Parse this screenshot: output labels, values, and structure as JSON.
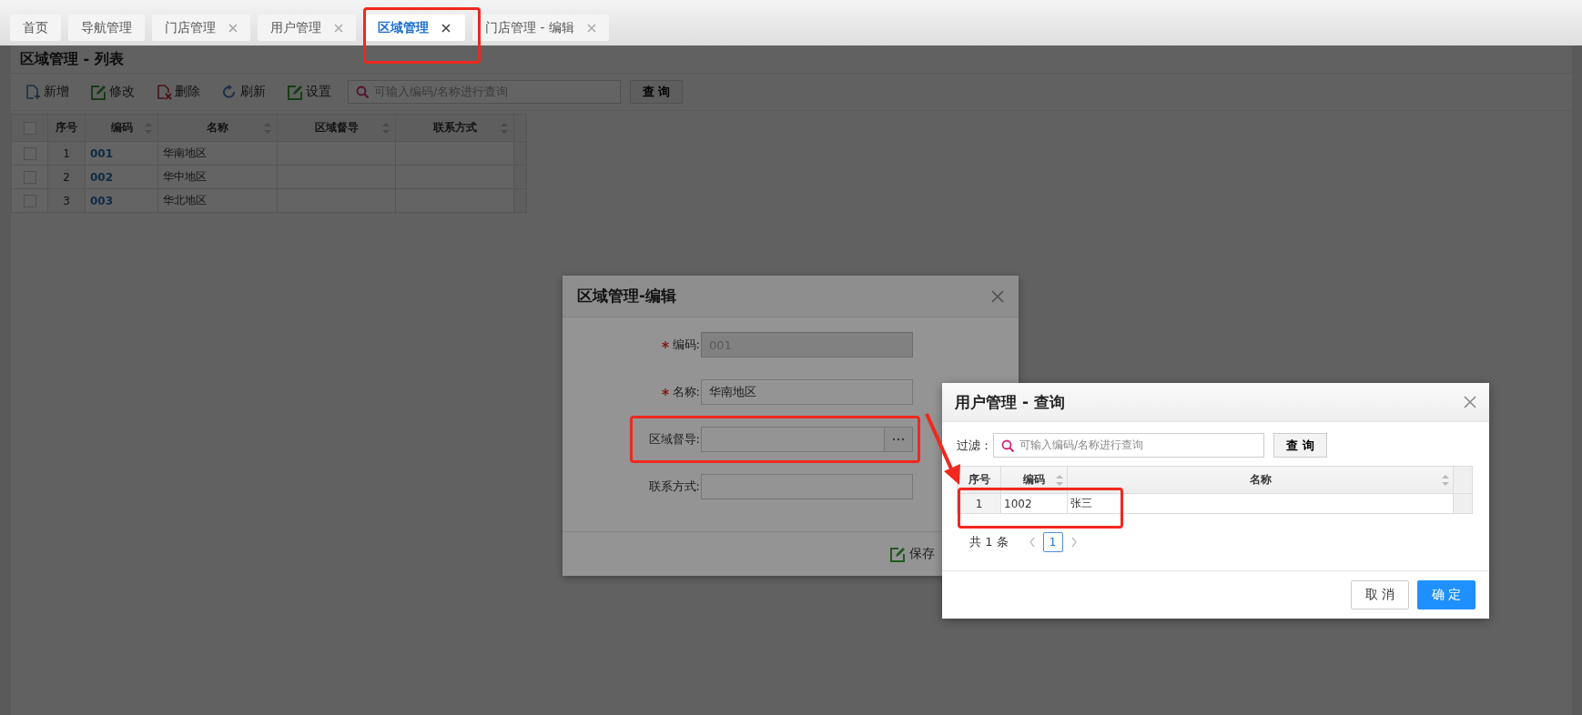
{
  "tabs": [
    {
      "label": "首页",
      "closable": false,
      "selected": false
    },
    {
      "label": "导航管理",
      "closable": false,
      "selected": false
    },
    {
      "label": "门店管理",
      "closable": true,
      "selected": false
    },
    {
      "label": "用户管理",
      "closable": true,
      "selected": false
    },
    {
      "label": "区域管理",
      "closable": true,
      "selected": true
    },
    {
      "label": "门店管理 - 编辑",
      "closable": true,
      "selected": false
    }
  ],
  "list_page": {
    "title": "区域管理 - 列表",
    "toolbar": [
      {
        "label": "新增",
        "kind": "add"
      },
      {
        "label": "修改",
        "kind": "edit"
      },
      {
        "label": "删除",
        "kind": "delete"
      },
      {
        "label": "刷新",
        "kind": "refresh"
      },
      {
        "label": "设置",
        "kind": "edit"
      }
    ],
    "search": {
      "placeholder": "可输入编码/名称进行查询"
    },
    "search_button": "查 询",
    "table": {
      "all_checked": false,
      "columns": [
        {
          "label": "序号",
          "sortable": false
        },
        {
          "label": "编码",
          "sortable": true
        },
        {
          "label": "名称",
          "sortable": true
        },
        {
          "label": "区域督导",
          "sortable": true
        },
        {
          "label": "联系方式",
          "sortable": true
        }
      ],
      "rows": [
        {
          "checked": false,
          "index": "1",
          "code": "001",
          "name": "华南地区"
        },
        {
          "checked": false,
          "index": "2",
          "code": "002",
          "name": "华中地区"
        },
        {
          "checked": false,
          "index": "3",
          "code": "003",
          "name": "华北地区"
        }
      ]
    }
  },
  "edit_dialog": {
    "title": "区域管理-编辑",
    "fields": [
      {
        "label": "编码:",
        "required": true,
        "kind": "text",
        "disabled": true,
        "value": "001"
      },
      {
        "label": "名称:",
        "required": true,
        "kind": "text",
        "disabled": false,
        "value": "华南地区"
      },
      {
        "label": "区域督导:",
        "required": false,
        "kind": "picker"
      },
      {
        "label": "联系方式:",
        "required": false,
        "kind": "text",
        "disabled": false
      }
    ],
    "save_button": "保存"
  },
  "query_dialog": {
    "title": "用户管理 - 查询",
    "filter_label": "过滤：",
    "search": {
      "placeholder": "可输入编码/名称进行查询"
    },
    "search_button": "查 询",
    "table": {
      "columns": [
        {
          "label": "序号",
          "sortable": false
        },
        {
          "label": "编码",
          "sortable": true
        },
        {
          "label": "名称",
          "sortable": true
        }
      ],
      "rows": [
        {
          "index": "1",
          "code": "1002",
          "name": "张三"
        }
      ]
    },
    "pagination": {
      "total": "共 1 条",
      "pages": [
        {
          "label": "1",
          "selected": true
        }
      ]
    },
    "buttons": [
      {
        "label": "取 消",
        "kind": "default"
      },
      {
        "label": "确 定",
        "kind": "primary"
      }
    ]
  }
}
